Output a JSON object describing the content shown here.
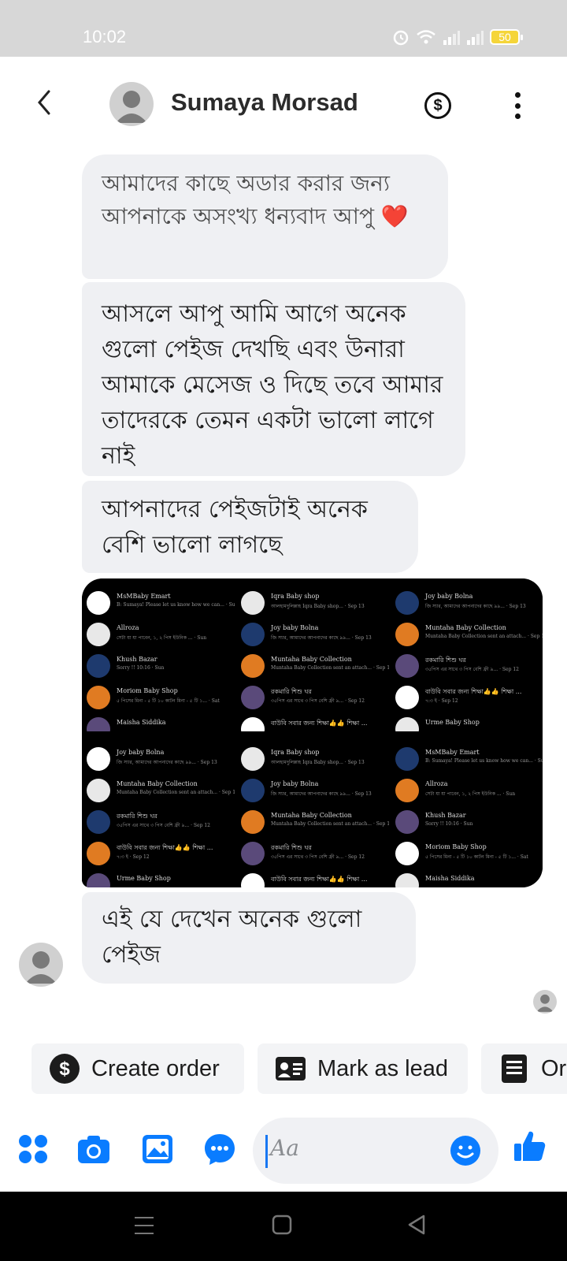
{
  "status_bar": {
    "time": "10:02",
    "battery": "50"
  },
  "header": {
    "contact_name": "Sumaya Morsad"
  },
  "messages": [
    {
      "text": "আমাদের কাছে অডার করার জন্য আপনাকে অসংখ্য ধন্যবাদ আপু",
      "emoji": "❤️"
    },
    {
      "text": "আসলে আপু আমি আগে অনেক গুলো পেইজ দেখছি এবং উনারা আমাকে মেসেজ ও দিছে তবে আমার তাদেরকে তেমন একটা ভালো লাগে নাই"
    },
    {
      "text": "আপনাদের পেইজটাই অনেক বেশি ভালো লাগছে"
    },
    {
      "text": "এই যে দেখেন অনেক গুলো পেইজ"
    }
  ],
  "screenshots": {
    "row1": [
      {
        "items": [
          {
            "name": "MsMBaby Emart",
            "snippet": "B: Sumaya! Please let us know how we can... · Sun"
          },
          {
            "name": "Allroza",
            "snippet": "সেটা যা যা পাবেন, ১, ২ পিস ইউনিক ... · Sun"
          },
          {
            "name": "Khush Bazar",
            "snippet": "Sorry !! 10:16 · Sun"
          },
          {
            "name": "Moriom Baby Shop",
            "snippet": "৫ পিসের মিনা - ৫ টি ১০ কাটন মিনা - ৫ টি ১... · Sat"
          },
          {
            "name": "Maisha Siddika",
            "snippet": ""
          }
        ]
      },
      {
        "items": [
          {
            "name": "Iqra Baby shop",
            "snippet": "আলহামদুলিল্লাহ Iqra Baby shop... · Sep 13"
          },
          {
            "name": "Joy baby Bolna",
            "snippet": "জি স্যার, আমাদের আপনাদের কাছে ৯৯... · Sep 13"
          },
          {
            "name": "Muntaha Baby Collection",
            "snippet": "Muntaha Baby Collection sent an attach... · Sep 13"
          },
          {
            "name": "রকমারি শিশু ঘর",
            "snippet": "৩৫পিস এর সাথে ৩ পিস বেশি ফ্রী ৯... · Sep 12"
          },
          {
            "name": "বাউবি সবার জন্য শিক্ষা👍👍 শিক্ষা ...",
            "snippet": ""
          }
        ]
      },
      {
        "items": [
          {
            "name": "Joy baby Bolna",
            "snippet": "জি স্যার, আমাদের আপনাদের কাছে ৯৯... · Sep 13"
          },
          {
            "name": "Muntaha Baby Collection",
            "snippet": "Muntaha Baby Collection sent an attach... · Sep 13"
          },
          {
            "name": "রকমারি শিশু ঘর",
            "snippet": "৩৫পিস এর সাথে ৩ পিস বেশি ফ্রী ৯... · Sep 12"
          },
          {
            "name": "বাউবি সবার জন্য শিক্ষা👍👍 শিক্ষা ...",
            "snippet": "৭:৩ ই · Sep 12"
          },
          {
            "name": "Urme Baby Shop",
            "snippet": ""
          }
        ]
      }
    ],
    "row2": [
      {
        "items": [
          {
            "name": "Joy baby Bolna",
            "snippet": "জি স্যার, আমাদের আপনাদের কাছে ৯৯... · Sep 13"
          },
          {
            "name": "Muntaha Baby Collection",
            "snippet": "Muntaha Baby Collection sent an attach... · Sep 13"
          },
          {
            "name": "রকমারি শিশু ঘর",
            "snippet": "৩৫পিস এর সাথে ৩ পিস বেশি ফ্রী ৯... · Sep 12"
          },
          {
            "name": "বাউবি সবার জন্য শিক্ষা👍👍 শিক্ষা ...",
            "snippet": "৭:৩ ই · Sep 12"
          },
          {
            "name": "Urme Baby Shop",
            "snippet": ""
          }
        ]
      },
      {
        "items": [
          {
            "name": "Iqra Baby shop",
            "snippet": "আলহামদুলিল্লাহ Iqra Baby shop... · Sep 13"
          },
          {
            "name": "Joy baby Bolna",
            "snippet": "জি স্যার, আমাদের আপনাদের কাছে ৯৯... · Sep 13"
          },
          {
            "name": "Muntaha Baby Collection",
            "snippet": "Muntaha Baby Collection sent an attach... · Sep 13"
          },
          {
            "name": "রকমারি শিশু ঘর",
            "snippet": "৩৫পিস এর সাথে ৩ পিস বেশি ফ্রী ৯... · Sep 12"
          },
          {
            "name": "বাউবি সবার জন্য শিক্ষা👍👍 শিক্ষা ...",
            "snippet": ""
          }
        ]
      },
      {
        "items": [
          {
            "name": "MsMBaby Emart",
            "snippet": "B: Sumaya! Please let us know how we can... · Sun"
          },
          {
            "name": "Allroza",
            "snippet": "সেটা যা যা পাবেন, ১, ২ পিস ইউনিক ... · Sun"
          },
          {
            "name": "Khush Bazar",
            "snippet": "Sorry !! 10:16 · Sun"
          },
          {
            "name": "Moriom Baby Shop",
            "snippet": "৫ পিসের মিনা - ৫ টি ১০ কাটন মিনা - ৫ টি ১... · Sat"
          },
          {
            "name": "Maisha Siddika",
            "snippet": ""
          }
        ]
      }
    ]
  },
  "quick_actions": {
    "create_order": "Create order",
    "mark_as_lead": "Mark as lead",
    "orders": "Or"
  },
  "composer": {
    "placeholder": "Aa"
  },
  "colors": {
    "accent": "#0a7cff",
    "bubble": "#eff0f3",
    "heart": "#e41e3f"
  }
}
